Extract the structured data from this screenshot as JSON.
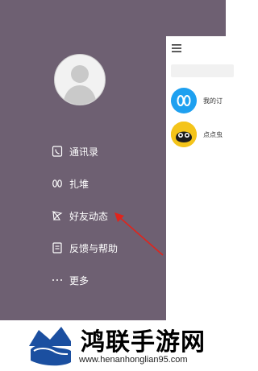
{
  "drawer": {
    "items": [
      {
        "label": "通讯录",
        "icon": "contacts-icon"
      },
      {
        "label": "扎堆",
        "icon": "footprints-icon"
      },
      {
        "label": "好友动态",
        "icon": "pinwheel-icon"
      },
      {
        "label": "反馈与帮助",
        "icon": "feedback-icon"
      },
      {
        "label": "更多",
        "icon": "more-dots-icon"
      }
    ]
  },
  "panel": {
    "contacts": [
      {
        "name": "我的订"
      },
      {
        "name": "点点虫"
      }
    ]
  },
  "watermark": {
    "brand": "鸿联手游网",
    "url": "www.henanhonglian95.com"
  },
  "colors": {
    "drawer_bg": "#6e6072",
    "accent_blue": "#1ea0f0",
    "arrow_red": "#e0241c",
    "bug_yellow": "#f4c41a"
  }
}
